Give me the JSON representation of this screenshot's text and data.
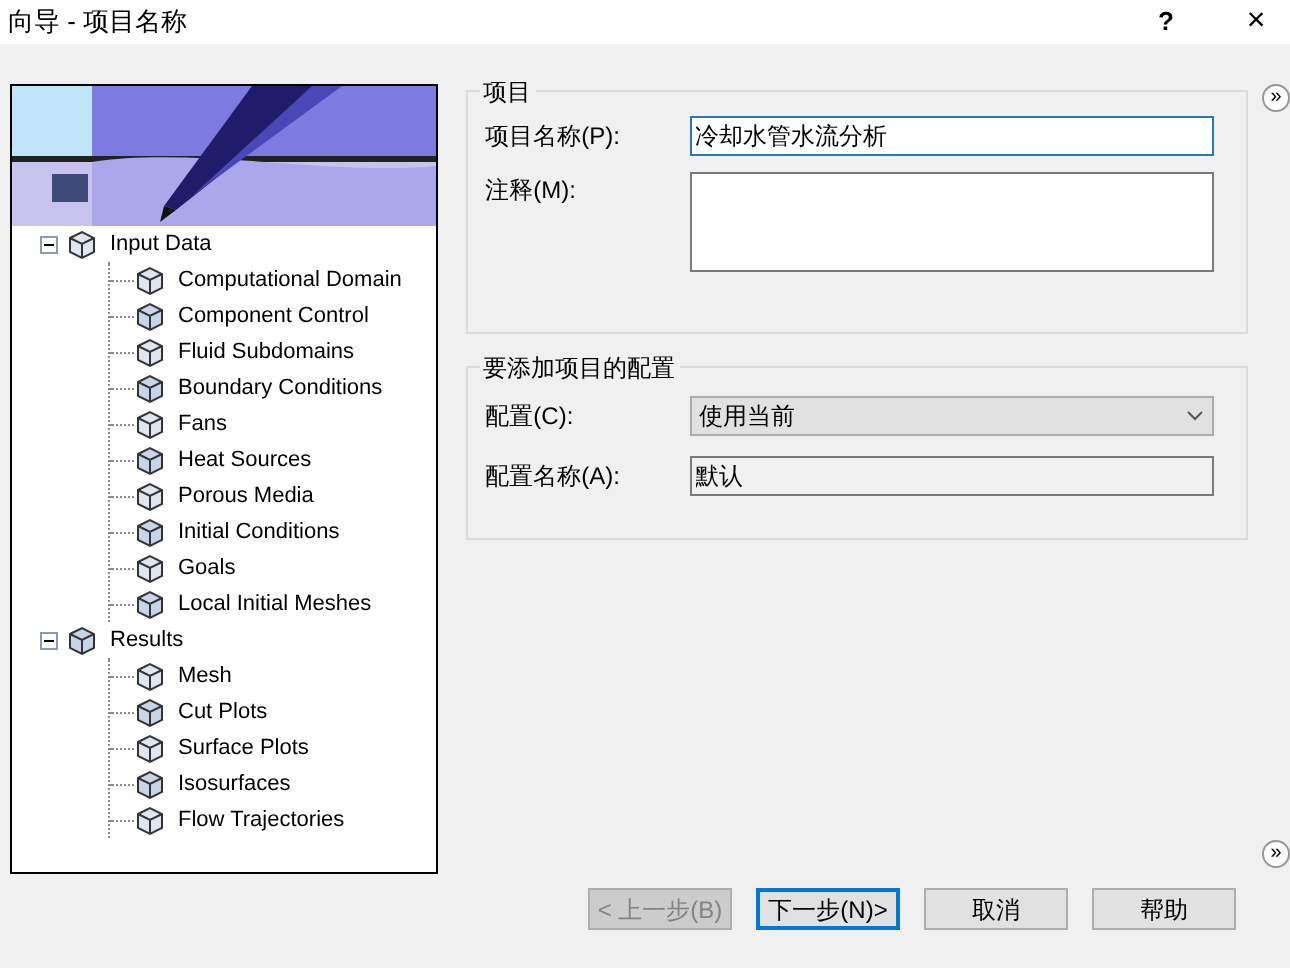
{
  "window": {
    "title": "向导 - 项目名称",
    "help": "?",
    "close": "×"
  },
  "tree": [
    {
      "label": "Input Data",
      "expanded": true,
      "children": [
        {
          "label": "Computational Domain"
        },
        {
          "label": "Component Control"
        },
        {
          "label": "Fluid Subdomains"
        },
        {
          "label": "Boundary Conditions"
        },
        {
          "label": "Fans"
        },
        {
          "label": "Heat Sources"
        },
        {
          "label": "Porous Media"
        },
        {
          "label": "Initial Conditions"
        },
        {
          "label": "Goals"
        },
        {
          "label": "Local Initial Meshes"
        }
      ]
    },
    {
      "label": "Results",
      "expanded": true,
      "children": [
        {
          "label": "Mesh"
        },
        {
          "label": "Cut Plots"
        },
        {
          "label": "Surface Plots"
        },
        {
          "label": "Isosurfaces"
        },
        {
          "label": "Flow Trajectories"
        }
      ]
    }
  ],
  "project_group": {
    "title": "项目",
    "name_label": "项目名称(P):",
    "name_value": "冷却水管水流分析",
    "notes_label": "注释(M):"
  },
  "config_group": {
    "title": "要添加项目的配置",
    "config_label": "配置(C):",
    "config_value": "使用当前",
    "config_name_label": "配置名称(A):",
    "config_name_value": "默认"
  },
  "expand_buttons": [
    "»",
    "»"
  ],
  "buttons": [
    {
      "label": "< 上一步(B)",
      "disabled": true,
      "selected": false
    },
    {
      "label": "下一步(N)>",
      "disabled": false,
      "selected": true
    },
    {
      "label": "取消",
      "disabled": false,
      "selected": false
    },
    {
      "label": "帮助",
      "disabled": false,
      "selected": false
    }
  ]
}
